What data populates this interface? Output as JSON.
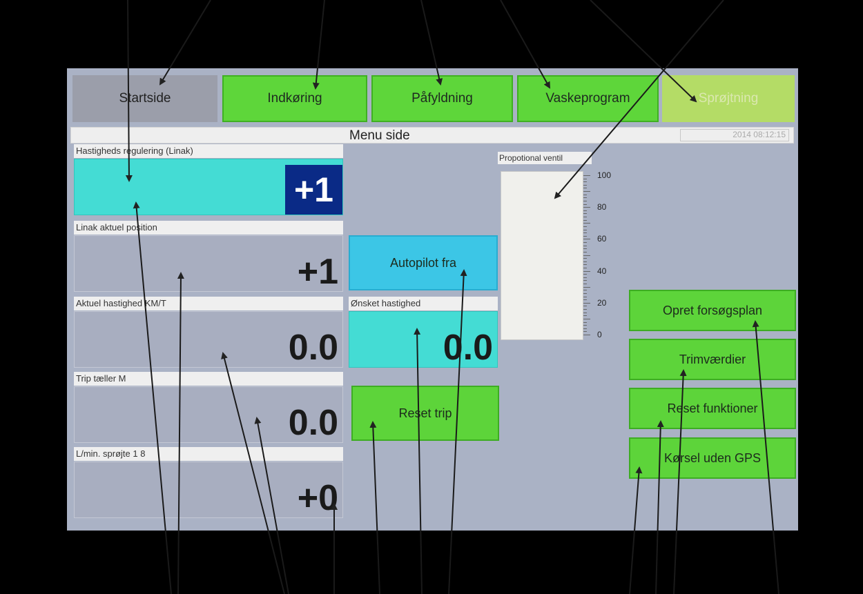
{
  "tabs": {
    "startside": "Startside",
    "indkoring": "Indkøring",
    "pafyldning": "Påfyldning",
    "vaskeprogram": "Vaskeprogram",
    "sprojtning": "Sprøjtning"
  },
  "header": {
    "title": "Menu side",
    "datetime": "2014 08:12:15"
  },
  "panels": {
    "hastighed_label": "Hastigheds regulering (Linak)",
    "hastighed_value": "+1",
    "linak_label": "Linak aktuel position",
    "linak_value": "+1",
    "aktuel_label": "Aktuel hastighed  KM/T",
    "aktuel_value": "0.0",
    "trip_label": "Trip tæller M",
    "trip_value": "0.0",
    "lmin_label": "L/min. sprøjte 1  8",
    "lmin_value": "+0"
  },
  "middle": {
    "autopilot_label": "Autopilot fra",
    "onsket_label": "Ønsket hastighed",
    "onsket_value": "0.0",
    "reset_trip_label": "Reset trip"
  },
  "gauge": {
    "title": "Propotional ventil",
    "scale_labels": [
      "100",
      "80",
      "60",
      "40",
      "20",
      "0"
    ],
    "value_percent": 0
  },
  "right_buttons": {
    "opret": "Opret forsøgsplan",
    "trim": "Trimværdier",
    "reset_funktioner": "Reset funktioner",
    "korsel": "Kørsel uden GPS"
  }
}
